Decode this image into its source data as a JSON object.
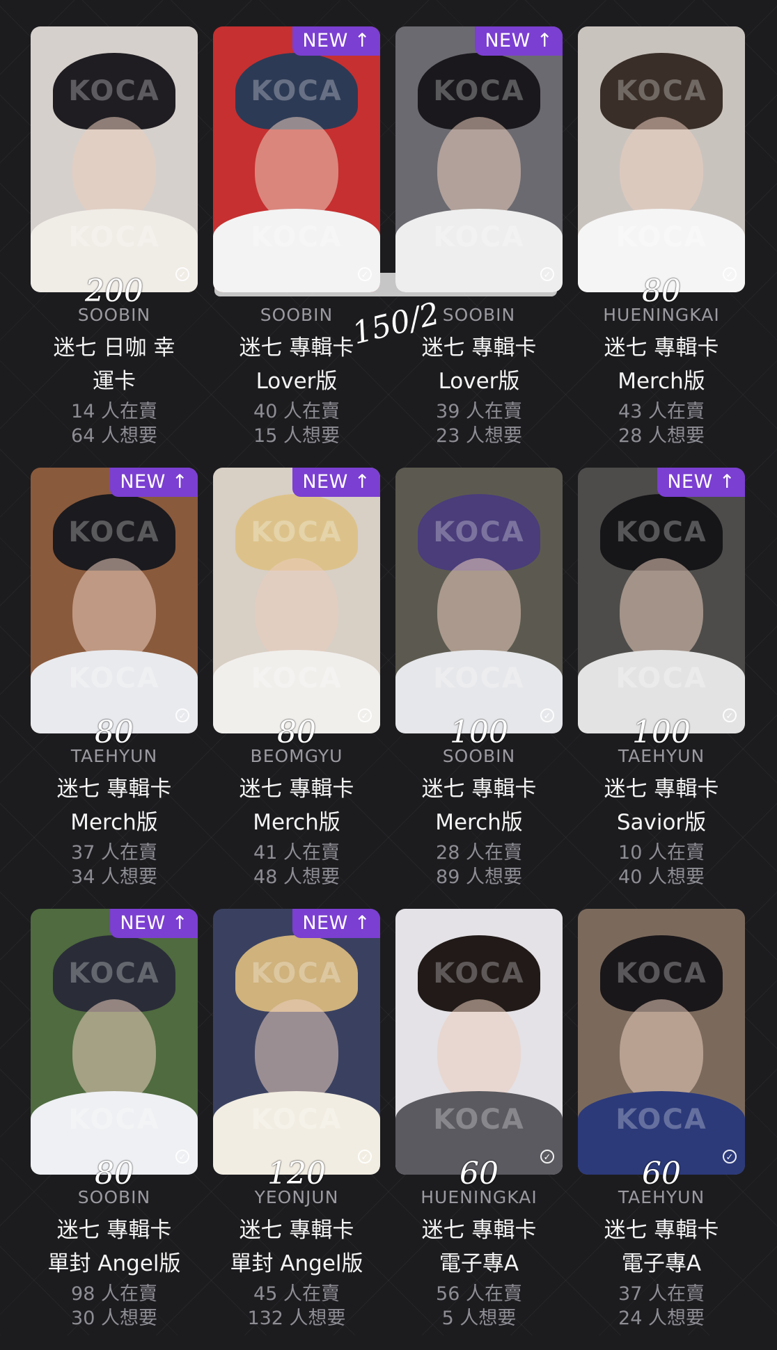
{
  "watermark": "KOCA",
  "check_glyph": "✓",
  "extra_note": "150/2",
  "cards": [
    {
      "new": "",
      "price": "200",
      "member": "SOOBIN",
      "title_1": "迷七 日咖 幸",
      "title_2": "運卡",
      "sellers": "14 人在賣",
      "wanted": "64 人想要",
      "colors": {
        "bg": "#d6d0cc",
        "hair": "#1f1d22",
        "shirt": "#f0ece6"
      }
    },
    {
      "new": "NEW ↑",
      "price": "",
      "member": "SOOBIN",
      "title_1": "迷七 專輯卡",
      "title_2": "Lover版",
      "sellers": "40 人在賣",
      "wanted": "15 人想要",
      "colors": {
        "bg": "#c63030",
        "hair": "#2d3a55",
        "shirt": "#f3f3f3"
      }
    },
    {
      "new": "NEW ↑",
      "price": "",
      "member": "SOOBIN",
      "title_1": "迷七 專輯卡",
      "title_2": "Lover版",
      "sellers": "39 人在賣",
      "wanted": "23 人想要",
      "colors": {
        "bg": "#6b6a70",
        "hair": "#1a181c",
        "shirt": "#eeeeee"
      }
    },
    {
      "new": "",
      "price": "80",
      "member": "HUENINGKAI",
      "title_1": "迷七 專輯卡",
      "title_2": "Merch版",
      "sellers": "43 人在賣",
      "wanted": "28 人想要",
      "colors": {
        "bg": "#c9c3be",
        "hair": "#3a2e28",
        "shirt": "#f5f5f5"
      }
    },
    {
      "new": "NEW ↑",
      "price": "80",
      "member": "TAEHYUN",
      "title_1": "迷七 專輯卡",
      "title_2": "Merch版",
      "sellers": "37 人在賣",
      "wanted": "34 人想要",
      "colors": {
        "bg": "#8a5a3c",
        "hair": "#1b1a1e",
        "shirt": "#e9eaee"
      }
    },
    {
      "new": "NEW ↑",
      "price": "80",
      "member": "BEOMGYU",
      "title_1": "迷七 專輯卡",
      "title_2": "Merch版",
      "sellers": "41 人在賣",
      "wanted": "48 人想要",
      "colors": {
        "bg": "#d8cfc5",
        "hair": "#dcc28a",
        "shirt": "#f1efec"
      }
    },
    {
      "new": "",
      "price": "100",
      "member": "SOOBIN",
      "title_1": "迷七 專輯卡",
      "title_2": "Merch版",
      "sellers": "28 人在賣",
      "wanted": "89 人想要",
      "colors": {
        "bg": "#5c5a50",
        "hair": "#4a3d7a",
        "shirt": "#e6e7ea"
      }
    },
    {
      "new": "NEW ↑",
      "price": "100",
      "member": "TAEHYUN",
      "title_1": "迷七 專輯卡",
      "title_2": "Savior版",
      "sellers": "10 人在賣",
      "wanted": "40 人想要",
      "colors": {
        "bg": "#4d4c4a",
        "hair": "#161518",
        "shirt": "#e3e3e3"
      }
    },
    {
      "new": "NEW ↑",
      "price": "80",
      "member": "SOOBIN",
      "title_1": "迷七 專輯卡",
      "title_2": "單封 Angel版",
      "sellers": "98 人在賣",
      "wanted": "30 人想要",
      "colors": {
        "bg": "#4f6b3f",
        "hair": "#2a2d38",
        "shirt": "#eef0f3"
      }
    },
    {
      "new": "NEW ↑",
      "price": "120",
      "member": "YEONJUN",
      "title_1": "迷七 專輯卡",
      "title_2": "單封 Angel版",
      "sellers": "45 人在賣",
      "wanted": "132 人想要",
      "colors": {
        "bg": "#3a4160",
        "hair": "#cfb27c",
        "shirt": "#f2ede2"
      }
    },
    {
      "new": "",
      "price": "60",
      "member": "HUENINGKAI",
      "title_1": "迷七 專輯卡",
      "title_2": "電子專A",
      "sellers": "56 人在賣",
      "wanted": "5 人想要",
      "colors": {
        "bg": "#e4e2e6",
        "hair": "#211a18",
        "shirt": "#5a5a60"
      }
    },
    {
      "new": "",
      "price": "60",
      "member": "TAEHYUN",
      "title_1": "迷七 專輯卡",
      "title_2": "電子專A",
      "sellers": "37 人在賣",
      "wanted": "24 人想要",
      "colors": {
        "bg": "#7b6a5c",
        "hair": "#1a171a",
        "shirt": "#2c3a7a"
      }
    }
  ]
}
